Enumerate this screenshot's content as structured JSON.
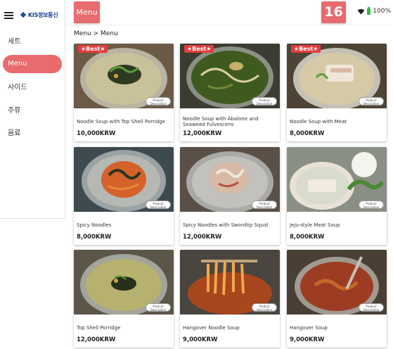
{
  "sidebar": {
    "logo_text": "KIS정보통신",
    "items": [
      {
        "label": "세트",
        "active": false
      },
      {
        "label": "Menu",
        "active": true
      },
      {
        "label": "사이드",
        "active": false
      },
      {
        "label": "주류",
        "active": false
      },
      {
        "label": "음료",
        "active": false
      }
    ]
  },
  "header": {
    "menu_label": "Menu",
    "table_number": "16",
    "battery": "100%",
    "breadcrumb": "Menu > Menu"
  },
  "badges": {
    "best": "★Best★",
    "description": "Product Description"
  },
  "products": [
    {
      "name": "Noodle Soup with Top Shell Porridge",
      "price": "10,000KRW",
      "best": true,
      "photo": "porridge-noodle"
    },
    {
      "name": "Noodle Soup with Abalone and Seaweed Fulvescens",
      "price": "12,000KRW",
      "best": true,
      "photo": "seaweed-noodle"
    },
    {
      "name": "Noodle Soup with Meat",
      "price": "8,000KRW",
      "best": true,
      "photo": "meat-noodle"
    },
    {
      "name": "Spicy Noodles",
      "price": "8,000KRW",
      "best": false,
      "photo": "spicy-noodles"
    },
    {
      "name": "Spicy Noodles with Swordtip Squid",
      "price": "12,000KRW",
      "best": false,
      "photo": "squid-noodles"
    },
    {
      "name": "Jeju-style Meat Soup",
      "price": "8,000KRW",
      "best": false,
      "photo": "meat-soup"
    },
    {
      "name": "Top Shell Porridge",
      "price": "12,000KRW",
      "best": false,
      "photo": "porridge"
    },
    {
      "name": "Hangover Noodle Soup",
      "price": "9,000KRW",
      "best": false,
      "photo": "hangover-noodle"
    },
    {
      "name": "Hangover Soup",
      "price": "9,000KRW",
      "best": false,
      "photo": "hangover-soup"
    }
  ],
  "colors": {
    "accent": "#e86b6e",
    "best_badge": "#e23d3d",
    "battery": "#2dbb3f"
  }
}
